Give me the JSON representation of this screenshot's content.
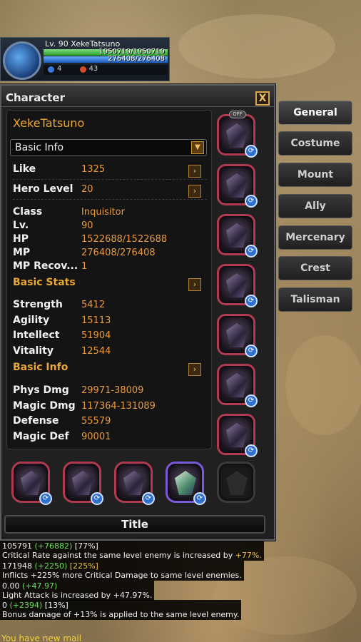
{
  "player": {
    "name": "Lv. 90 XekeTatsuno",
    "hp": "1950719/1950719",
    "mp": "276408/276408",
    "buff_count_1": "4",
    "buff_count_2": "43"
  },
  "window": {
    "title": "Character",
    "close_label": "X",
    "character_name": "XekeTatsuno",
    "dropdown_value": "Basic Info",
    "dropdown_arrow": "▼",
    "arrow_symbol": "›",
    "title_button": "Title"
  },
  "stats": {
    "like_label": "Like",
    "like_value": "1325",
    "hero_label": "Hero Level",
    "hero_value": "20",
    "class_label": "Class",
    "class_value": "Inquisitor",
    "lv_label": "Lv.",
    "lv_value": "90",
    "hp_label": "HP",
    "hp_value": "1522688/1522688",
    "mp_label": "MP",
    "mp_value": "276408/276408",
    "mprec_label": "MP Recov...",
    "mprec_value": "1",
    "section_basic_stats": "Basic Stats",
    "str_label": "Strength",
    "str_value": "5412",
    "agi_label": "Agility",
    "agi_value": "15113",
    "int_label": "Intellect",
    "int_value": "51904",
    "vit_label": "Vitality",
    "vit_value": "12544",
    "section_basic_info": "Basic Info",
    "pdmg_label": "Phys Dmg",
    "pdmg_value": "29971-38009",
    "mdmg_label": "Magic Dmg",
    "mdmg_value": "117364-131089",
    "def_label": "Defense",
    "def_value": "55579",
    "mdef_label": "Magic Def",
    "mdef_value": "90001"
  },
  "equipment": {
    "off_badge": "OFF",
    "sync_symbol": "⟳"
  },
  "tabs": [
    "General",
    "Costume",
    "Mount",
    "Ally",
    "Mercenary",
    "Crest",
    "Talisman"
  ],
  "tooltips": {
    "t1_base": "105791 ",
    "t1_bonus": "(+76882)",
    "t1_pct": " [77%]",
    "t1_desc": "Critical Rate against the same level enemy is increased by ",
    "t1_desc_val": "+77%.",
    "t2_base": "171948 ",
    "t2_bonus": "(+2250)",
    "t2_pct": " [225%]",
    "t2_desc": "Inflicts +225% more Critical Damage to same level enemies.",
    "t3_base": "0.00 ",
    "t3_bonus": "(+47.97)",
    "t3_desc": "Light Attack is increased by +47.97%.",
    "t4_base": "0 ",
    "t4_bonus": "(+2394)",
    "t4_pct": " [13%]",
    "t4_desc": "Bonus damage of +13% is applied to the same level enemy."
  },
  "mail": "You have new mail"
}
